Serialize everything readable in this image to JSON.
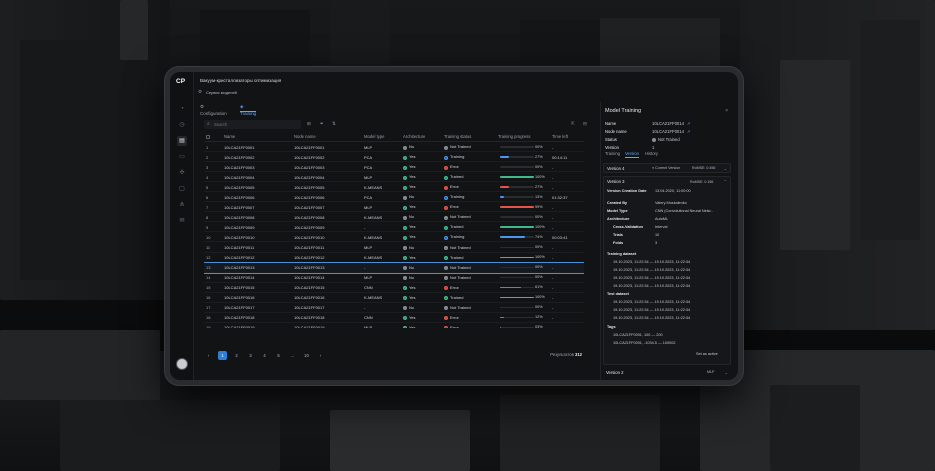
{
  "app": {
    "title": "Вакуум-кристаллизаторы оптимизация",
    "service": "Сервис моделей",
    "logo": "CP",
    "tabs": [
      "Configuration",
      "Training"
    ],
    "active_tab": "Training"
  },
  "toolbar": {
    "search_placeholder": "Search"
  },
  "table": {
    "columns": [
      "Name",
      "Node name",
      "Model type",
      "Architecture",
      "Training status",
      "Training progress",
      "Time left"
    ],
    "rows": [
      {
        "n": "1",
        "name": "10LCA21FF0001",
        "node": "10LCA21FF0001",
        "type": "MLP",
        "arch": "No",
        "status": "Not Trained",
        "progress": 0,
        "pct": "00%",
        "time": "-"
      },
      {
        "n": "2",
        "name": "10LCA21FF0002",
        "node": "10LCA21FF0002",
        "type": "PCA",
        "arch": "Yes",
        "status": "Training",
        "progress": 27,
        "pct": "27%",
        "time": "00:14:11"
      },
      {
        "n": "3",
        "name": "10LCA21FF0003",
        "node": "10LCA21FF0003",
        "type": "PCA",
        "arch": "Yes",
        "status": "Error",
        "progress": 0,
        "pct": "00%",
        "time": "-"
      },
      {
        "n": "4",
        "name": "10LCA21FF0004",
        "node": "10LCA21FF0004",
        "type": "MLP",
        "arch": "Yes",
        "status": "Trained",
        "progress": 100,
        "pct": "100%",
        "time": "-"
      },
      {
        "n": "5",
        "name": "10LCA21FF0005",
        "node": "10LCA21FF0005",
        "type": "K-MEANS",
        "arch": "Yes",
        "status": "Error",
        "progress": 27,
        "pct": "27%",
        "time": "-"
      },
      {
        "n": "6",
        "name": "10LCA21FF0006",
        "node": "10LCA21FF0006",
        "type": "PCA",
        "arch": "No",
        "status": "Training",
        "progress": 13,
        "pct": "13%",
        "time": "01:32:37"
      },
      {
        "n": "7",
        "name": "10LCA21FF0007",
        "node": "10LCA21FF0007",
        "type": "MLP",
        "arch": "Yes",
        "status": "Error",
        "progress": 99,
        "pct": "99%",
        "time": "-"
      },
      {
        "n": "8",
        "name": "10LCA21FF0008",
        "node": "10LCA21FF0008",
        "type": "K-MEANS",
        "arch": "No",
        "status": "Not Trained",
        "progress": 0,
        "pct": "00%",
        "time": "-"
      },
      {
        "n": "9",
        "name": "10LCA21FF0009",
        "node": "10LCA21FF0009",
        "type": "-",
        "arch": "Yes",
        "status": "Trained",
        "progress": 100,
        "pct": "100%",
        "time": "-"
      },
      {
        "n": "10",
        "name": "10LCA21FF0010",
        "node": "10LCA21FF0010",
        "type": "K-MEANS",
        "arch": "Yes",
        "status": "Training",
        "progress": 74,
        "pct": "74%",
        "time": "00:03:41"
      },
      {
        "n": "11",
        "name": "10LCA21FF0011",
        "node": "10LCA21FF0011",
        "type": "MLP",
        "arch": "No",
        "status": "Not Trained",
        "progress": 0,
        "pct": "00%",
        "time": "-"
      },
      {
        "n": "12",
        "name": "10LCA21FF0012",
        "node": "10LCA21FF0012",
        "type": "K-MEANS",
        "arch": "Yes",
        "status": "Trained",
        "progress": 100,
        "pct": "100%",
        "time": "-"
      },
      {
        "n": "13",
        "name": "10LCA21FF0013",
        "node": "10LCA21FF0013",
        "type": "-",
        "arch": "No",
        "status": "Not Trained",
        "progress": 0,
        "pct": "00%",
        "time": "-"
      },
      {
        "n": "14",
        "name": "10LCA21FF0014",
        "node": "10LCA21FF0014",
        "type": "MLP",
        "arch": "No",
        "status": "Not Trained",
        "progress": 0,
        "pct": "00%",
        "time": "-"
      },
      {
        "n": "15",
        "name": "10LCA21FF0015",
        "node": "10LCA21FF0015",
        "type": "CNN",
        "arch": "Yes",
        "status": "Error",
        "progress": 61,
        "pct": "61%",
        "time": "-"
      },
      {
        "n": "16",
        "name": "10LCA21FF0016",
        "node": "10LCA21FF0016",
        "type": "K-MEANS",
        "arch": "Yes",
        "status": "Trained",
        "progress": 100,
        "pct": "100%",
        "time": "-"
      },
      {
        "n": "17",
        "name": "10LCA21FF0017",
        "node": "10LCA21FF0017",
        "type": "-",
        "arch": "No",
        "status": "Not Trained",
        "progress": 0,
        "pct": "00%",
        "time": "-"
      },
      {
        "n": "18",
        "name": "10LCA21FF0018",
        "node": "10LCA21FF0018",
        "type": "CNN",
        "arch": "Yes",
        "status": "Error",
        "progress": 12,
        "pct": "12%",
        "time": "-"
      },
      {
        "n": "19",
        "name": "10LCA21FF0019",
        "node": "10LCA21FF0019",
        "type": "MLP",
        "arch": "Yes",
        "status": "Error",
        "progress": 3,
        "pct": "03%",
        "time": "-"
      },
      {
        "n": "20",
        "name": "10LCA21FF0020",
        "node": "10LCA21FF0020",
        "type": "-",
        "arch": "No",
        "status": "Not Trained",
        "progress": 0,
        "pct": "00%",
        "time": "-"
      },
      {
        "n": "21",
        "name": "10LCA21FF0021",
        "node": "10LCA21FF0021",
        "type": "CNN",
        "arch": "Yes",
        "status": "Error",
        "progress": 48,
        "pct": "48%",
        "time": "-"
      }
    ],
    "selected_row": "13"
  },
  "pagination": {
    "pages": [
      "1",
      "2",
      "3",
      "4",
      "5",
      "...",
      "10"
    ],
    "active": "1",
    "results_label": "Результатов",
    "results_count": "312",
    "prev": "‹",
    "next": "›"
  },
  "status_colors": {
    "Not Trained": "#8a8f97",
    "Training": "#4c95f0",
    "Error": "#e5534b",
    "Trained": "#3fb98b"
  },
  "panel": {
    "title": "Model Training",
    "fields": [
      {
        "k": "Name",
        "v": "10LCA21FF0014"
      },
      {
        "k": "Node name",
        "v": "10LCA21FF0014"
      },
      {
        "k": "Status",
        "v": "Not Trained"
      },
      {
        "k": "Version",
        "v": "1"
      }
    ],
    "tabs": [
      "Training",
      "Version",
      "History"
    ],
    "active_tab": "Version",
    "v4": {
      "name": "Version 4",
      "current": "Current Version",
      "rmse": "RoMSE: 0.456"
    },
    "v3": {
      "name": "Version 3",
      "rmse": "RoMSE: 0.156",
      "details": [
        {
          "k": "Version Creation Date",
          "v": "13.04.2020, 11:00:00"
        },
        {
          "k": "Created By",
          "v": "Valery Moskalenko"
        },
        {
          "k": "Model Type",
          "v": "CNN (Convolutional Neural Netw..."
        },
        {
          "k": "Architecture",
          "v": "AutoML"
        },
        {
          "k": "Cross-Validation",
          "v": "Interval"
        },
        {
          "k": "Trials",
          "v": "10"
        },
        {
          "k": "Folds",
          "v": "3"
        }
      ],
      "training_label": "Training dataset",
      "training": [
        "19.10.2023, 11:22:34 — 19.10.2023, 11:22:34",
        "19.10.2023, 11:22:34 — 19.10.2023, 11:22:34",
        "19.10.2023, 11:22:34 — 19.10.2023, 11:22:34",
        "19.10.2023, 11:22:34 — 19.10.2023, 11:22:34"
      ],
      "test_label": "Test dataset",
      "test": [
        "19.10.2023, 11:22:34 — 19.10.2023, 11:22:34",
        "19.10.2023, 11:22:34 — 19.10.2023, 11:22:34",
        "19.10.2023, 11:22:34 — 19.10.2023, 11:22:34"
      ],
      "tags_label": "Tags",
      "tags": [
        "10LCA21FF0001, 100 — 200",
        "10LCA21FF0001, -1034.5 — 100002"
      ],
      "action": "Set as active"
    },
    "v2": {
      "name": "Version 2",
      "type": "MLP"
    }
  }
}
